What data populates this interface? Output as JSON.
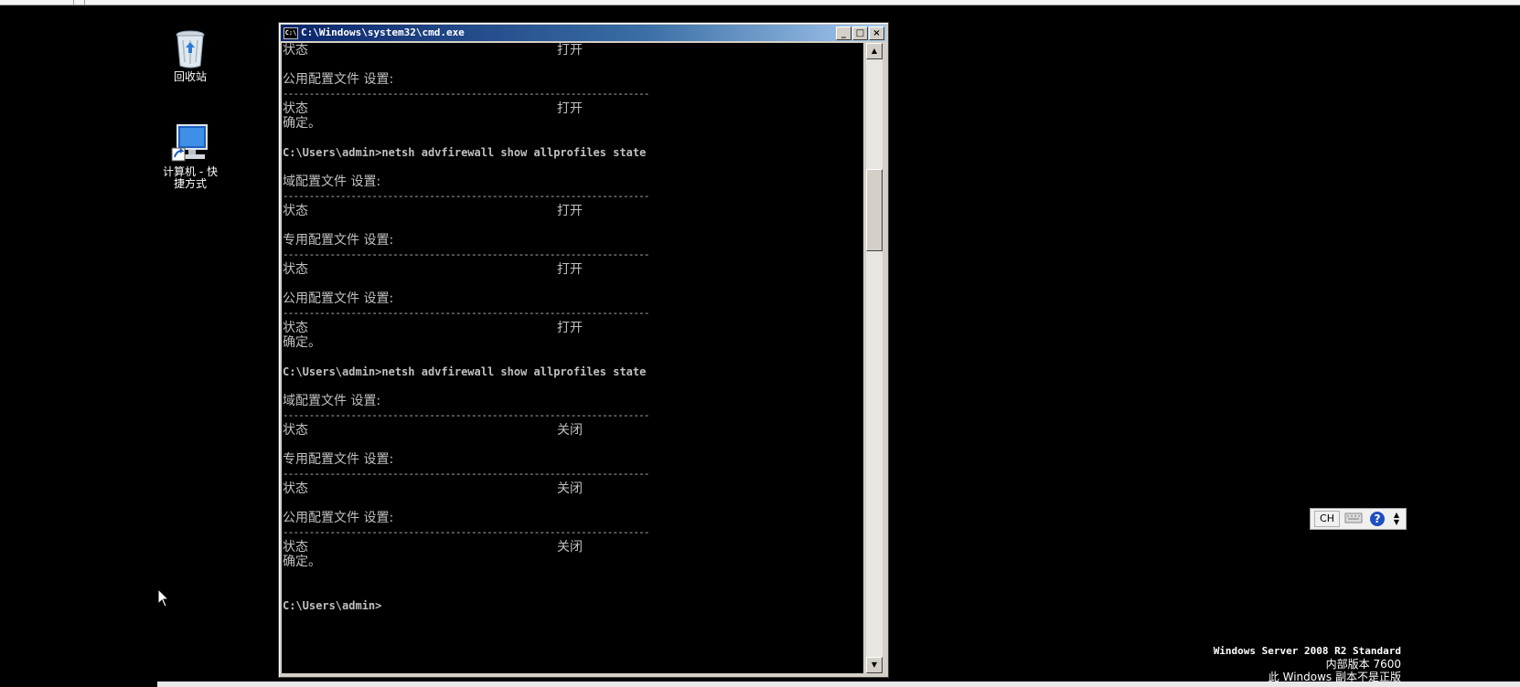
{
  "desktop": {
    "icons": [
      {
        "name": "recycle-bin",
        "label": "回收站"
      },
      {
        "name": "computer-shortcut",
        "label": "计算机 - 快\n捷方式"
      }
    ]
  },
  "cmd_window": {
    "title": "C:\\Windows\\system32\\cmd.exe",
    "icon_text": "C:\\",
    "buttons": {
      "minimize": "_",
      "maximize": "□",
      "close": "×"
    },
    "lines": [
      {
        "text": "状态",
        "value": "打开"
      },
      {
        "text": ""
      },
      {
        "text": "公用配置文件 设置:"
      },
      {
        "text": "----------------------------------------------------------------------"
      },
      {
        "text": "状态",
        "value": "打开"
      },
      {
        "text": "确定。"
      },
      {
        "text": ""
      },
      {
        "text": "C:\\Users\\admin>netsh advfirewall show allprofiles state"
      },
      {
        "text": ""
      },
      {
        "text": "域配置文件 设置:"
      },
      {
        "text": "----------------------------------------------------------------------"
      },
      {
        "text": "状态",
        "value": "打开"
      },
      {
        "text": ""
      },
      {
        "text": "专用配置文件 设置:"
      },
      {
        "text": "----------------------------------------------------------------------"
      },
      {
        "text": "状态",
        "value": "打开"
      },
      {
        "text": ""
      },
      {
        "text": "公用配置文件 设置:"
      },
      {
        "text": "----------------------------------------------------------------------"
      },
      {
        "text": "状态",
        "value": "打开"
      },
      {
        "text": "确定。"
      },
      {
        "text": ""
      },
      {
        "text": "C:\\Users\\admin>netsh advfirewall show allprofiles state"
      },
      {
        "text": ""
      },
      {
        "text": "域配置文件 设置:"
      },
      {
        "text": "----------------------------------------------------------------------"
      },
      {
        "text": "状态",
        "value": "关闭"
      },
      {
        "text": ""
      },
      {
        "text": "专用配置文件 设置:"
      },
      {
        "text": "----------------------------------------------------------------------"
      },
      {
        "text": "状态",
        "value": "关闭"
      },
      {
        "text": ""
      },
      {
        "text": "公用配置文件 设置:"
      },
      {
        "text": "----------------------------------------------------------------------"
      },
      {
        "text": "状态",
        "value": "关闭"
      },
      {
        "text": "确定。"
      },
      {
        "text": ""
      },
      {
        "text": ""
      },
      {
        "text": "C:\\Users\\admin>"
      }
    ]
  },
  "language_bar": {
    "lang": "CH"
  },
  "watermark": {
    "line1": "Windows Server 2008 R2 Standard",
    "line2": "内部版本 7600",
    "line3": "此 Windows 副本不是正版"
  },
  "colors": {
    "console_bg": "#000000",
    "console_text": "#c0c0c0",
    "titlebar": "#0a246a"
  }
}
